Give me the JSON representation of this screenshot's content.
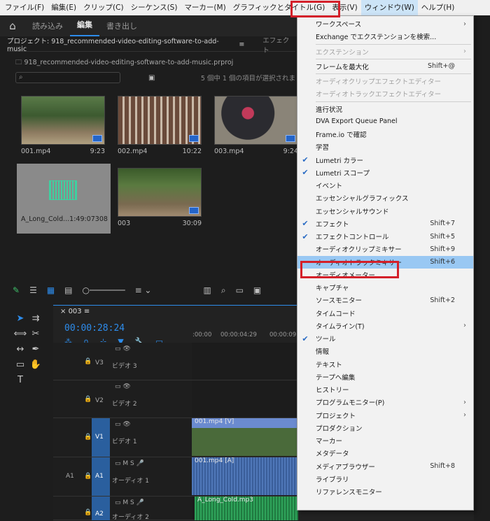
{
  "menubar": {
    "items": [
      "ファイル(F)",
      "編集(E)",
      "クリップ(C)",
      "シーケンス(S)",
      "マーカー(M)",
      "グラフィックとタイトル(G)",
      "表示(V)",
      "ウィンドウ(W)",
      "ヘルプ(H)"
    ]
  },
  "workspace": {
    "tabs": [
      "読み込み",
      "編集",
      "書き出し"
    ]
  },
  "project": {
    "title": "プロジェクト: 918_recommended-video-editing-software-to-add-music",
    "effects_tab": "エフェクト",
    "file": "918_recommended-video-editing-software-to-add-music.prproj",
    "status": "5 個中 1 個の項目が選択されま",
    "clips": [
      {
        "name": "001.mp4",
        "duration": "9:23"
      },
      {
        "name": "002.mp4",
        "duration": "10:22"
      },
      {
        "name": "003.mp4",
        "duration": "9:24"
      },
      {
        "name": "A_Long_Cold...",
        "duration": "1:49:07308"
      },
      {
        "name": "003",
        "duration": "30:09"
      }
    ]
  },
  "timeline": {
    "sequence": "003",
    "timecode": "00:00:28:24",
    "ruler": [
      ":00:00",
      "00:00:04:29",
      "00:00:09"
    ],
    "tracks": [
      {
        "id": "V3",
        "name": "ビデオ 3"
      },
      {
        "id": "V2",
        "name": "ビデオ 2"
      },
      {
        "id": "V1",
        "name": "ビデオ 1"
      },
      {
        "id": "A1",
        "name": "オーディオ 1"
      },
      {
        "id": "A2",
        "name": "オーディオ 2"
      }
    ],
    "clips": {
      "v1": "001.mp4 [V]",
      "a1": "001.mp4 [A]",
      "a2": "A_Long_Cold.mp3"
    }
  },
  "window_menu": {
    "items": [
      {
        "label": "ワークスペース",
        "submenu": true
      },
      {
        "label": "Exchange でエクステンションを検索..."
      },
      {
        "sep": true
      },
      {
        "label": "エクステンション",
        "submenu": true,
        "disabled": true
      },
      {
        "sep": true
      },
      {
        "label": "フレームを最大化",
        "shortcut": "Shift+@"
      },
      {
        "sep": true
      },
      {
        "label": "オーディオクリップエフェクトエディター",
        "disabled": true
      },
      {
        "label": "オーディオトラックエフェクトエディター",
        "disabled": true
      },
      {
        "sep": true
      },
      {
        "label": "進行状況"
      },
      {
        "label": "DVA Export Queue Panel"
      },
      {
        "label": "Frame.io で確認"
      },
      {
        "label": "学習"
      },
      {
        "label": "Lumetri カラー",
        "checked": true
      },
      {
        "label": "Lumetri スコープ",
        "checked": true
      },
      {
        "label": "イベント"
      },
      {
        "label": "エッセンシャルグラフィックス"
      },
      {
        "label": "エッセンシャルサウンド"
      },
      {
        "label": "エフェクト",
        "checked": true,
        "shortcut": "Shift+7"
      },
      {
        "label": "エフェクトコントロール",
        "checked": true,
        "shortcut": "Shift+5"
      },
      {
        "label": "オーディオクリップミキサー",
        "shortcut": "Shift+9"
      },
      {
        "label": "オーディオトラックミキサー",
        "shortcut": "Shift+6",
        "hover": true
      },
      {
        "label": "オーディオメーター"
      },
      {
        "label": "キャプチャ"
      },
      {
        "label": "ソースモニター",
        "shortcut": "Shift+2"
      },
      {
        "label": "タイムコード"
      },
      {
        "label": "タイムライン(T)",
        "submenu": true
      },
      {
        "label": "ツール",
        "checked": true
      },
      {
        "label": "情報"
      },
      {
        "label": "テキスト"
      },
      {
        "label": "テープへ編集"
      },
      {
        "label": "ヒストリー"
      },
      {
        "label": "プログラムモニター(P)",
        "submenu": true
      },
      {
        "label": "プロジェクト",
        "submenu": true
      },
      {
        "label": "プロダクション"
      },
      {
        "label": "マーカー"
      },
      {
        "label": "メタデータ"
      },
      {
        "label": "メディアブラウザー",
        "shortcut": "Shift+8"
      },
      {
        "label": "ライブラリ"
      },
      {
        "label": "リファレンスモニター"
      }
    ]
  },
  "colors": {
    "accent": "#2d8ceb",
    "highlight_box": "#d4202a",
    "hover": "#99c8f3"
  }
}
